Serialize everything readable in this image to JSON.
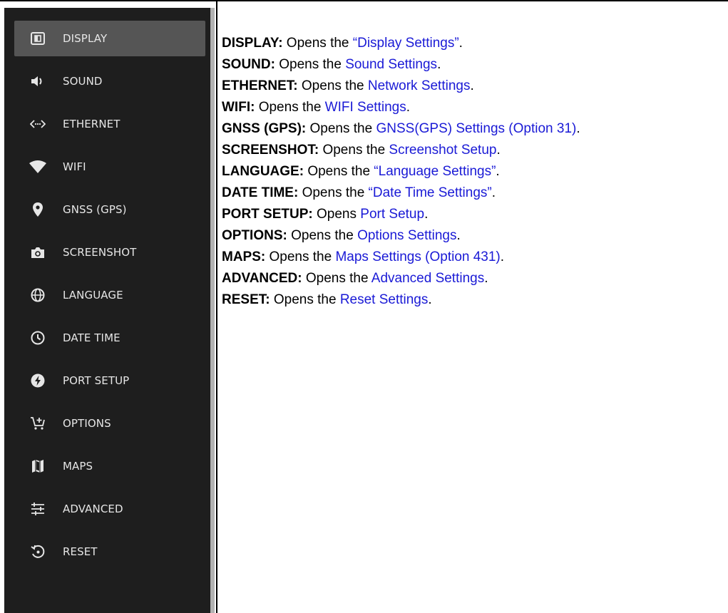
{
  "sidebar": {
    "items": [
      {
        "label": "DISPLAY",
        "icon": "display-icon",
        "active": true
      },
      {
        "label": "SOUND",
        "icon": "speaker-icon",
        "active": false
      },
      {
        "label": "ETHERNET",
        "icon": "ethernet-icon",
        "active": false
      },
      {
        "label": "WIFI",
        "icon": "wifi-icon",
        "active": false
      },
      {
        "label": "GNSS (GPS)",
        "icon": "location-pin-icon",
        "active": false
      },
      {
        "label": "SCREENSHOT",
        "icon": "camera-icon",
        "active": false
      },
      {
        "label": "LANGUAGE",
        "icon": "globe-icon",
        "active": false
      },
      {
        "label": "DATE TIME",
        "icon": "clock-icon",
        "active": false
      },
      {
        "label": "PORT SETUP",
        "icon": "lightning-icon",
        "active": false
      },
      {
        "label": "OPTIONS",
        "icon": "cart-add-icon",
        "active": false
      },
      {
        "label": "MAPS",
        "icon": "map-icon",
        "active": false
      },
      {
        "label": "ADVANCED",
        "icon": "sliders-icon",
        "active": false
      },
      {
        "label": "RESET",
        "icon": "reset-icon",
        "active": false
      }
    ]
  },
  "descriptions": [
    {
      "term": "DISPLAY:",
      "text": " Opens the ",
      "link": "“Display Settings”",
      "end": "."
    },
    {
      "term": "SOUND:",
      "text": " Opens the ",
      "link": "Sound Settings",
      "end": "."
    },
    {
      "term": "ETHERNET:",
      "text": " Opens the ",
      "link": "Network Settings",
      "end": "."
    },
    {
      "term": "WIFI:",
      "text": " Opens the ",
      "link": "WIFI Settings",
      "end": "."
    },
    {
      "term": "GNSS (GPS):",
      "text": " Opens the ",
      "link": "GNSS(GPS) Settings (Option 31)",
      "end": "."
    },
    {
      "term": "SCREENSHOT:",
      "text": " Opens the ",
      "link": "Screenshot Setup",
      "end": "."
    },
    {
      "term": "LANGUAGE:",
      "text": " Opens the ",
      "link": "“Language Settings”",
      "end": "."
    },
    {
      "term": "DATE TIME:",
      "text": " Opens the ",
      "link": "“Date Time Settings”",
      "end": "."
    },
    {
      "term": "PORT SETUP:",
      "text": " Opens ",
      "link": "Port Setup",
      "end": "."
    },
    {
      "term": "OPTIONS:",
      "text": " Opens the ",
      "link": "Options Settings",
      "end": "."
    },
    {
      "term": "MAPS:",
      "text": " Opens the ",
      "link": "Maps Settings (Option 431)",
      "end": "."
    },
    {
      "term": "ADVANCED:",
      "text": " Opens the ",
      "link": "Advanced Settings",
      "end": "."
    },
    {
      "term": "RESET:",
      "text": " Opens the ",
      "link": "Reset Settings",
      "end": "."
    }
  ],
  "colors": {
    "panel_bg": "#1e1e1e",
    "active_bg": "#555555",
    "label": "#e6e6e6",
    "link": "#1a1ad6"
  }
}
